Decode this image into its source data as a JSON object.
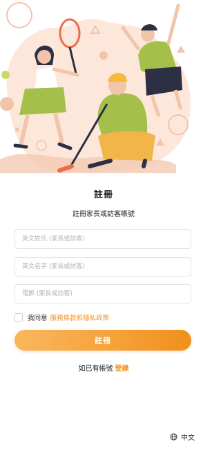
{
  "header": {
    "title": "註冊",
    "subtitle": "註冊家長或訪客賬號"
  },
  "form": {
    "last_name_placeholder": "英文姓氏 (家長或訪客)",
    "first_name_placeholder": "英文名字 (家長或訪客)",
    "email_placeholder": "電郵 (家長或訪客)",
    "agree_text": "我同意",
    "policy_link": "服務條款和隱私政策",
    "submit_label": "註冊"
  },
  "login": {
    "prompt": "如已有帳號",
    "link": "登錄"
  },
  "language": {
    "label": "中文",
    "icon": "globe-icon"
  },
  "colors": {
    "accent": "#f0931e",
    "illustration_bg": "#fbe3d4",
    "figure_green": "#a4c04b"
  }
}
